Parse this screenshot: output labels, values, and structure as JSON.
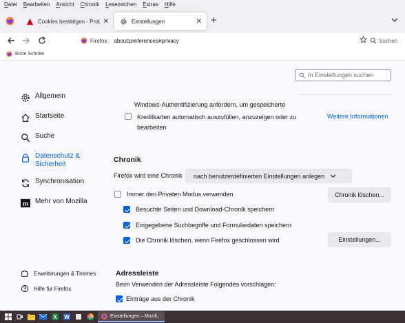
{
  "menubar": [
    "Datei",
    "Bearbeiten",
    "Ansicht",
    "Chronik",
    "Lesezeichen",
    "Extras",
    "Hilfe"
  ],
  "tabs": [
    {
      "title": "Cookies bestätigen - Probleme auf",
      "active": false
    },
    {
      "title": "Einstellungen",
      "active": true
    }
  ],
  "urlbar": {
    "identity": "Firefox",
    "url": "about:preferences#privacy"
  },
  "search": {
    "label": "Suchen"
  },
  "bookmarks": {
    "first": "Erste Schritte"
  },
  "prefs_search": {
    "placeholder": "In Einstellungen suchen"
  },
  "nav": {
    "general": "Allgemein",
    "home": "Startseite",
    "search": "Suche",
    "privacy": "Datenschutz & Sicherheit",
    "sync": "Synchronisation",
    "more": "Mehr von Mozilla",
    "extensions": "Erweiterungen & Themes",
    "help": "Hilfe für Firefox"
  },
  "forms": {
    "windows_auth": "Windows-Authentifizierung anfordern, um gespeicherte",
    "autofill_cc": "Kreditkarten automatisch auszufüllen, anzuzeigen oder zu bearbeiten",
    "more_info": "Weitere Informationen"
  },
  "history": {
    "heading": "Chronik",
    "will_label": "Firefox wird eine Chronik",
    "mode": "nach benutzerdefinierten Einstellungen anlegen",
    "private_mode": "Immer den Privaten Modus verwenden",
    "clear_button": "Chronik löschen...",
    "remember_browsing": "Besuchte Seiten und Download-Chronik speichern",
    "remember_search": "Eingegebene Suchbegriffe und Formulardaten speichern",
    "clear_on_close": "Die Chronik löschen, wenn Firefox geschlossen wird",
    "settings_button": "Einstellungen..."
  },
  "addressbar": {
    "heading": "Adressleiste",
    "subtitle": "Beim Verwenden der Adressleiste Folgendes vorschlagen:",
    "history_entries": "Einträge aus der Chronik"
  },
  "taskbar": {
    "task": "Einstellungen – Mozill..."
  },
  "colors": {
    "accent": "#0061e0",
    "content_bg": "#f9f9fb",
    "chrome_bg": "#f0f0f4"
  }
}
